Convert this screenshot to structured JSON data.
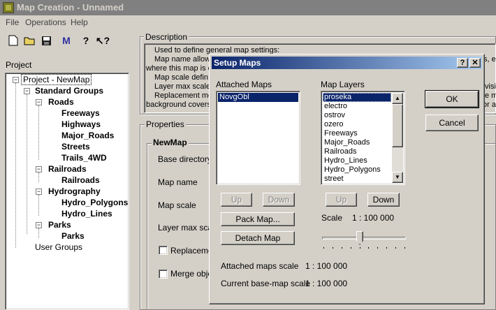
{
  "window": {
    "title": "Map Creation - Unnamed"
  },
  "menu": [
    "File",
    "Operations",
    "Help"
  ],
  "toolbar": {
    "icons": [
      "new-icon",
      "open-icon",
      "save-icon",
      "map-icon",
      "help-icon",
      "context-help-icon"
    ],
    "map_glyph": "M"
  },
  "project": {
    "label": "Project",
    "root": "Project - NewMap",
    "standard_groups": "Standard Groups",
    "roads": "Roads",
    "roads_items": [
      "Freeways",
      "Highways",
      "Major_Roads",
      "Streets",
      "Trails_4WD"
    ],
    "railroads": "Railroads",
    "railroads_items": [
      "Railroads"
    ],
    "hydrography": "Hydrography",
    "hydrography_items": [
      "Hydro_Polygons",
      "Hydro_Lines"
    ],
    "parks": "Parks",
    "parks_items": [
      "Parks"
    ],
    "user_groups": "User Groups"
  },
  "description": {
    "label": "Description",
    "lines": [
      "Used to define general map settings:",
      "Map name allow",
      "where this map is c",
      "Map scale defin",
      "Layer max scale",
      "Replacement mo",
      "background covers"
    ],
    "right_fragments": [
      "s, e",
      "visi",
      "e ma",
      "or ac"
    ]
  },
  "properties": {
    "label": "Properties",
    "newmap_label": "NewMap",
    "fields": [
      "Base directory",
      "Map name",
      "Map scale",
      "Layer max scale"
    ],
    "checkboxes": [
      "Replaceme",
      "Merge obje"
    ]
  },
  "dialog": {
    "title": "Setup Maps",
    "help_btn": "?",
    "close_btn": "✕",
    "attached_label": "Attached Maps",
    "attached_items": [
      "NovgObl"
    ],
    "layers_label": "Map Layers",
    "layer_items": [
      "proseka",
      "electro",
      "ostrov",
      "ozero",
      "Freeways",
      "Major_Roads",
      "Railroads",
      "Hydro_Lines",
      "Hydro_Polygons",
      "street"
    ],
    "up": "Up",
    "down": "Down",
    "pack": "Pack Map...",
    "detach": "Detach Map",
    "ok": "OK",
    "cancel": "Cancel",
    "scale_label": "Scale",
    "scale_value": "1 : 100 000",
    "slider_position": 0.45,
    "attached_scale_label": "Attached maps scale",
    "attached_scale_value": "1 : 100 000",
    "current_scale_label": "Current base-map scale",
    "current_scale_value": "1 : 100 000"
  }
}
